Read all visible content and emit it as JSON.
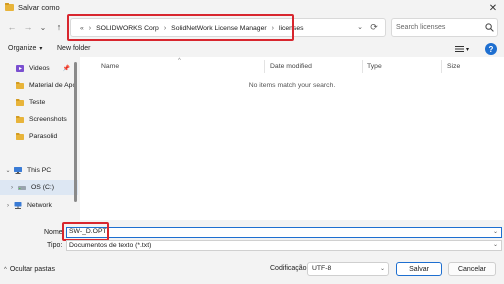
{
  "window": {
    "title": "Salvar como",
    "close_glyph": "✕"
  },
  "nav": {
    "back_glyph": "←",
    "forward_glyph": "→",
    "recent_glyph": "⌄",
    "up_glyph": "↑",
    "refresh_glyph": "⟳",
    "address_dropdown_glyph": "⌄"
  },
  "address": {
    "overflow": "«",
    "crumbs": [
      "SOLIDWORKS Corp",
      "SolidNetWork License Manager",
      "licenses"
    ],
    "separator": "›"
  },
  "search": {
    "placeholder": "Search licenses"
  },
  "commandbar": {
    "organize": "Organize",
    "organize_caret": "▾",
    "new_folder": "New folder",
    "view_caret": "▾",
    "help": "?"
  },
  "sidebar": {
    "items": [
      {
        "label": "Videos",
        "icon": "video-folder-icon",
        "pinned": true
      },
      {
        "label": "Material de Apo",
        "icon": "folder-icon"
      },
      {
        "label": "Teste",
        "icon": "folder-icon"
      },
      {
        "label": "Screenshots",
        "icon": "folder-icon"
      },
      {
        "label": "Parasolid",
        "icon": "folder-icon"
      }
    ],
    "this_pc": "This PC",
    "os_drive": "OS (C:)",
    "network": "Network",
    "expanded_glyph": "⌄",
    "collapsed_glyph": "›",
    "pin_glyph": "📌"
  },
  "filelist": {
    "columns": [
      "Name",
      "Date modified",
      "Type",
      "Size"
    ],
    "sort_glyph": "^",
    "empty_message": "No items match your search."
  },
  "form": {
    "name_label": "Nome:",
    "name_value": "SW-_D.OPT",
    "type_label": "Tipo:",
    "type_value": "Documentos de texto (*.txt)",
    "dropdown_glyph": "⌄",
    "encoding_label": "Codificação:",
    "encoding_value": "UTF-8",
    "hide_folders": "Ocultar pastas",
    "hide_caret": "^",
    "save": "Salvar",
    "cancel": "Cancelar"
  },
  "colors": {
    "accent": "#1e6fd0",
    "highlight": "#d8262e",
    "folder": "#e8b43a"
  }
}
